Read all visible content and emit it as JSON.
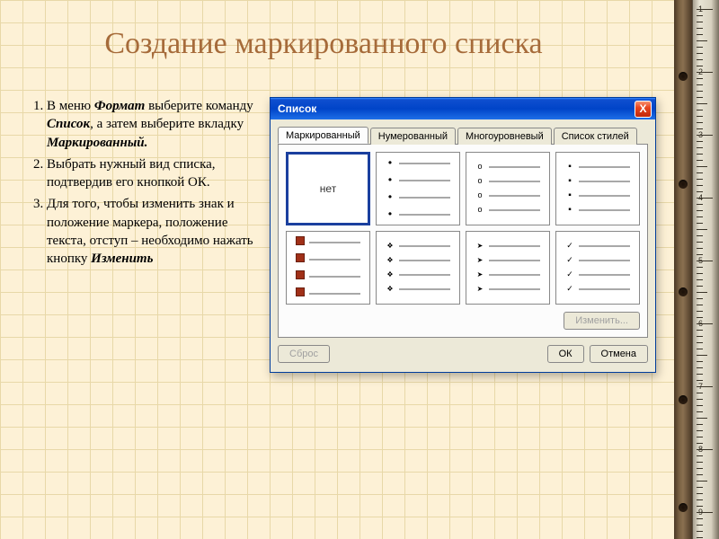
{
  "title": "Создание маркированного списка",
  "instructions": {
    "items": [
      {
        "pre": "В меню ",
        "em1": "Формат",
        "mid1": " выберите команду ",
        "em2": "Список",
        "mid2": ", а затем выберите вкладку ",
        "em3": "Маркированный."
      },
      {
        "text": "Выбрать нужный вид списка, подтвердив его кнопкой ОК."
      },
      {
        "pre": "Для того, чтобы изменить знак и положение маркера, положение текста, отступ – необходимо нажать кнопку ",
        "em1": "Изменить"
      }
    ]
  },
  "dialog": {
    "title": "Список",
    "close_icon": "X",
    "tabs": [
      {
        "label": "Маркированный",
        "ukey": "М"
      },
      {
        "label": "Нумерованный",
        "ukey": "Н"
      },
      {
        "label": "Многоуровневый",
        "ukey": ""
      },
      {
        "label": "Список стилей",
        "ukey": ""
      }
    ],
    "none_label": "нет",
    "buttons": {
      "change": "Изменить...",
      "reset": "Сброс",
      "ok": "ОК",
      "cancel": "Отмена"
    }
  }
}
